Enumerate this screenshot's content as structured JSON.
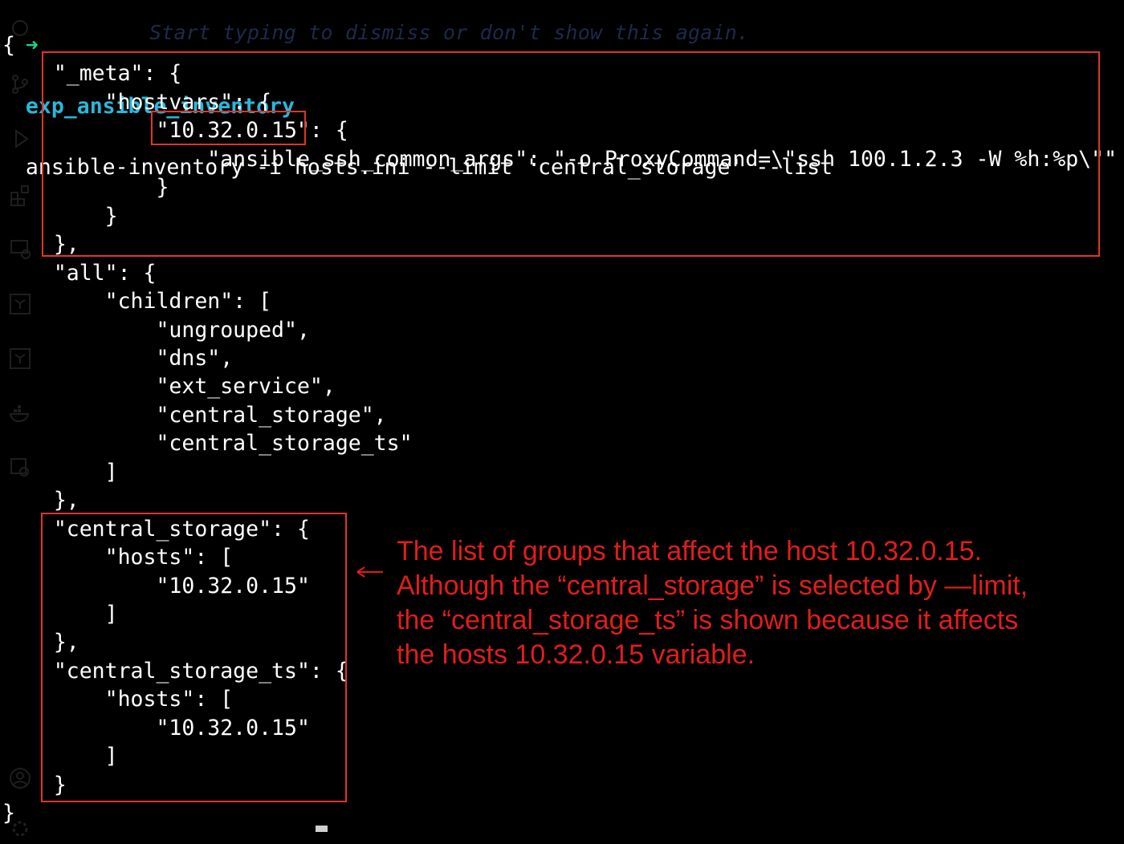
{
  "terminal": {
    "prompt_arrow": "➜",
    "directory": "exp_ansible_inventory",
    "command": "ansible-inventory -i hosts.ini --limit 'central_storage' --list",
    "ghost_hint": "Start typing to dismiss or don't show this again.",
    "output_lines": [
      "{",
      "    \"_meta\": {",
      "        \"hostvars\": {",
      "            \"10.32.0.15\": {",
      "                \"ansible_ssh_common_args\": \"-o ProxyCommand=\\\"ssh 100.1.2.3 -W %h:%p\\\"\"",
      "            }",
      "        }",
      "    },",
      "    \"all\": {",
      "        \"children\": [",
      "            \"ungrouped\",",
      "            \"dns\",",
      "            \"ext_service\",",
      "            \"central_storage\",",
      "            \"central_storage_ts\"",
      "        ]",
      "    },",
      "    \"central_storage\": {",
      "        \"hosts\": [",
      "            \"10.32.0.15\"",
      "        ]",
      "    },",
      "    \"central_storage_ts\": {",
      "        \"hosts\": [",
      "            \"10.32.0.15\"",
      "        ]",
      "    }",
      "}"
    ]
  },
  "annotation": {
    "lines": [
      "The list of groups that affect the host 10.32.0.15.",
      "Although the “central_storage” is selected by —limit,",
      "the “central_storage_ts” is shown because it affects",
      "the hosts 10.32.0.15 variable."
    ],
    "arrow_glyph": "←"
  },
  "colors": {
    "background": "#000000",
    "text": "#ffffff",
    "prompt_arrow": "#23d18b",
    "directory": "#29b8db",
    "highlight_box": "#e2342c",
    "annotation_text": "#e11d1d"
  },
  "activity_icons": [
    "files-icon",
    "source-control-icon",
    "run-debug-icon",
    "extensions-icon",
    "remote-explorer-icon",
    "terraform-icon",
    "terraform-icon",
    "docker-icon",
    "settings-sync-icon",
    "account-icon",
    "manage-gear-icon"
  ]
}
